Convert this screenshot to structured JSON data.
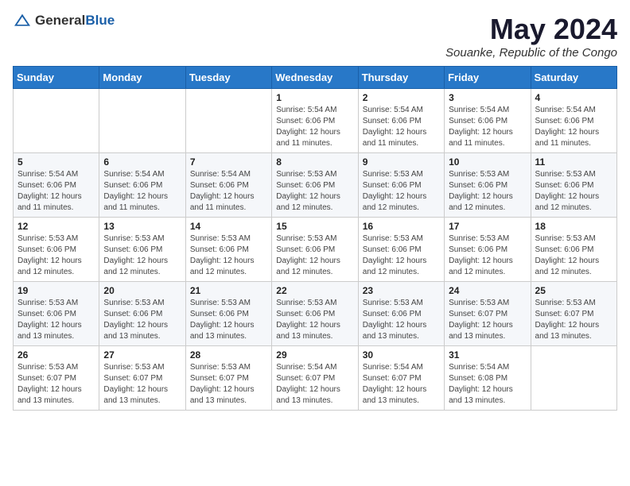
{
  "logo": {
    "general": "General",
    "blue": "Blue"
  },
  "header": {
    "month_year": "May 2024",
    "location": "Souanke, Republic of the Congo"
  },
  "weekdays": [
    "Sunday",
    "Monday",
    "Tuesday",
    "Wednesday",
    "Thursday",
    "Friday",
    "Saturday"
  ],
  "weeks": [
    [
      {
        "day": "",
        "info": ""
      },
      {
        "day": "",
        "info": ""
      },
      {
        "day": "",
        "info": ""
      },
      {
        "day": "1",
        "info": "Sunrise: 5:54 AM\nSunset: 6:06 PM\nDaylight: 12 hours\nand 11 minutes."
      },
      {
        "day": "2",
        "info": "Sunrise: 5:54 AM\nSunset: 6:06 PM\nDaylight: 12 hours\nand 11 minutes."
      },
      {
        "day": "3",
        "info": "Sunrise: 5:54 AM\nSunset: 6:06 PM\nDaylight: 12 hours\nand 11 minutes."
      },
      {
        "day": "4",
        "info": "Sunrise: 5:54 AM\nSunset: 6:06 PM\nDaylight: 12 hours\nand 11 minutes."
      }
    ],
    [
      {
        "day": "5",
        "info": "Sunrise: 5:54 AM\nSunset: 6:06 PM\nDaylight: 12 hours\nand 11 minutes."
      },
      {
        "day": "6",
        "info": "Sunrise: 5:54 AM\nSunset: 6:06 PM\nDaylight: 12 hours\nand 11 minutes."
      },
      {
        "day": "7",
        "info": "Sunrise: 5:54 AM\nSunset: 6:06 PM\nDaylight: 12 hours\nand 11 minutes."
      },
      {
        "day": "8",
        "info": "Sunrise: 5:53 AM\nSunset: 6:06 PM\nDaylight: 12 hours\nand 12 minutes."
      },
      {
        "day": "9",
        "info": "Sunrise: 5:53 AM\nSunset: 6:06 PM\nDaylight: 12 hours\nand 12 minutes."
      },
      {
        "day": "10",
        "info": "Sunrise: 5:53 AM\nSunset: 6:06 PM\nDaylight: 12 hours\nand 12 minutes."
      },
      {
        "day": "11",
        "info": "Sunrise: 5:53 AM\nSunset: 6:06 PM\nDaylight: 12 hours\nand 12 minutes."
      }
    ],
    [
      {
        "day": "12",
        "info": "Sunrise: 5:53 AM\nSunset: 6:06 PM\nDaylight: 12 hours\nand 12 minutes."
      },
      {
        "day": "13",
        "info": "Sunrise: 5:53 AM\nSunset: 6:06 PM\nDaylight: 12 hours\nand 12 minutes."
      },
      {
        "day": "14",
        "info": "Sunrise: 5:53 AM\nSunset: 6:06 PM\nDaylight: 12 hours\nand 12 minutes."
      },
      {
        "day": "15",
        "info": "Sunrise: 5:53 AM\nSunset: 6:06 PM\nDaylight: 12 hours\nand 12 minutes."
      },
      {
        "day": "16",
        "info": "Sunrise: 5:53 AM\nSunset: 6:06 PM\nDaylight: 12 hours\nand 12 minutes."
      },
      {
        "day": "17",
        "info": "Sunrise: 5:53 AM\nSunset: 6:06 PM\nDaylight: 12 hours\nand 12 minutes."
      },
      {
        "day": "18",
        "info": "Sunrise: 5:53 AM\nSunset: 6:06 PM\nDaylight: 12 hours\nand 12 minutes."
      }
    ],
    [
      {
        "day": "19",
        "info": "Sunrise: 5:53 AM\nSunset: 6:06 PM\nDaylight: 12 hours\nand 13 minutes."
      },
      {
        "day": "20",
        "info": "Sunrise: 5:53 AM\nSunset: 6:06 PM\nDaylight: 12 hours\nand 13 minutes."
      },
      {
        "day": "21",
        "info": "Sunrise: 5:53 AM\nSunset: 6:06 PM\nDaylight: 12 hours\nand 13 minutes."
      },
      {
        "day": "22",
        "info": "Sunrise: 5:53 AM\nSunset: 6:06 PM\nDaylight: 12 hours\nand 13 minutes."
      },
      {
        "day": "23",
        "info": "Sunrise: 5:53 AM\nSunset: 6:06 PM\nDaylight: 12 hours\nand 13 minutes."
      },
      {
        "day": "24",
        "info": "Sunrise: 5:53 AM\nSunset: 6:07 PM\nDaylight: 12 hours\nand 13 minutes."
      },
      {
        "day": "25",
        "info": "Sunrise: 5:53 AM\nSunset: 6:07 PM\nDaylight: 12 hours\nand 13 minutes."
      }
    ],
    [
      {
        "day": "26",
        "info": "Sunrise: 5:53 AM\nSunset: 6:07 PM\nDaylight: 12 hours\nand 13 minutes."
      },
      {
        "day": "27",
        "info": "Sunrise: 5:53 AM\nSunset: 6:07 PM\nDaylight: 12 hours\nand 13 minutes."
      },
      {
        "day": "28",
        "info": "Sunrise: 5:53 AM\nSunset: 6:07 PM\nDaylight: 12 hours\nand 13 minutes."
      },
      {
        "day": "29",
        "info": "Sunrise: 5:54 AM\nSunset: 6:07 PM\nDaylight: 12 hours\nand 13 minutes."
      },
      {
        "day": "30",
        "info": "Sunrise: 5:54 AM\nSunset: 6:07 PM\nDaylight: 12 hours\nand 13 minutes."
      },
      {
        "day": "31",
        "info": "Sunrise: 5:54 AM\nSunset: 6:08 PM\nDaylight: 12 hours\nand 13 minutes."
      },
      {
        "day": "",
        "info": ""
      }
    ]
  ]
}
